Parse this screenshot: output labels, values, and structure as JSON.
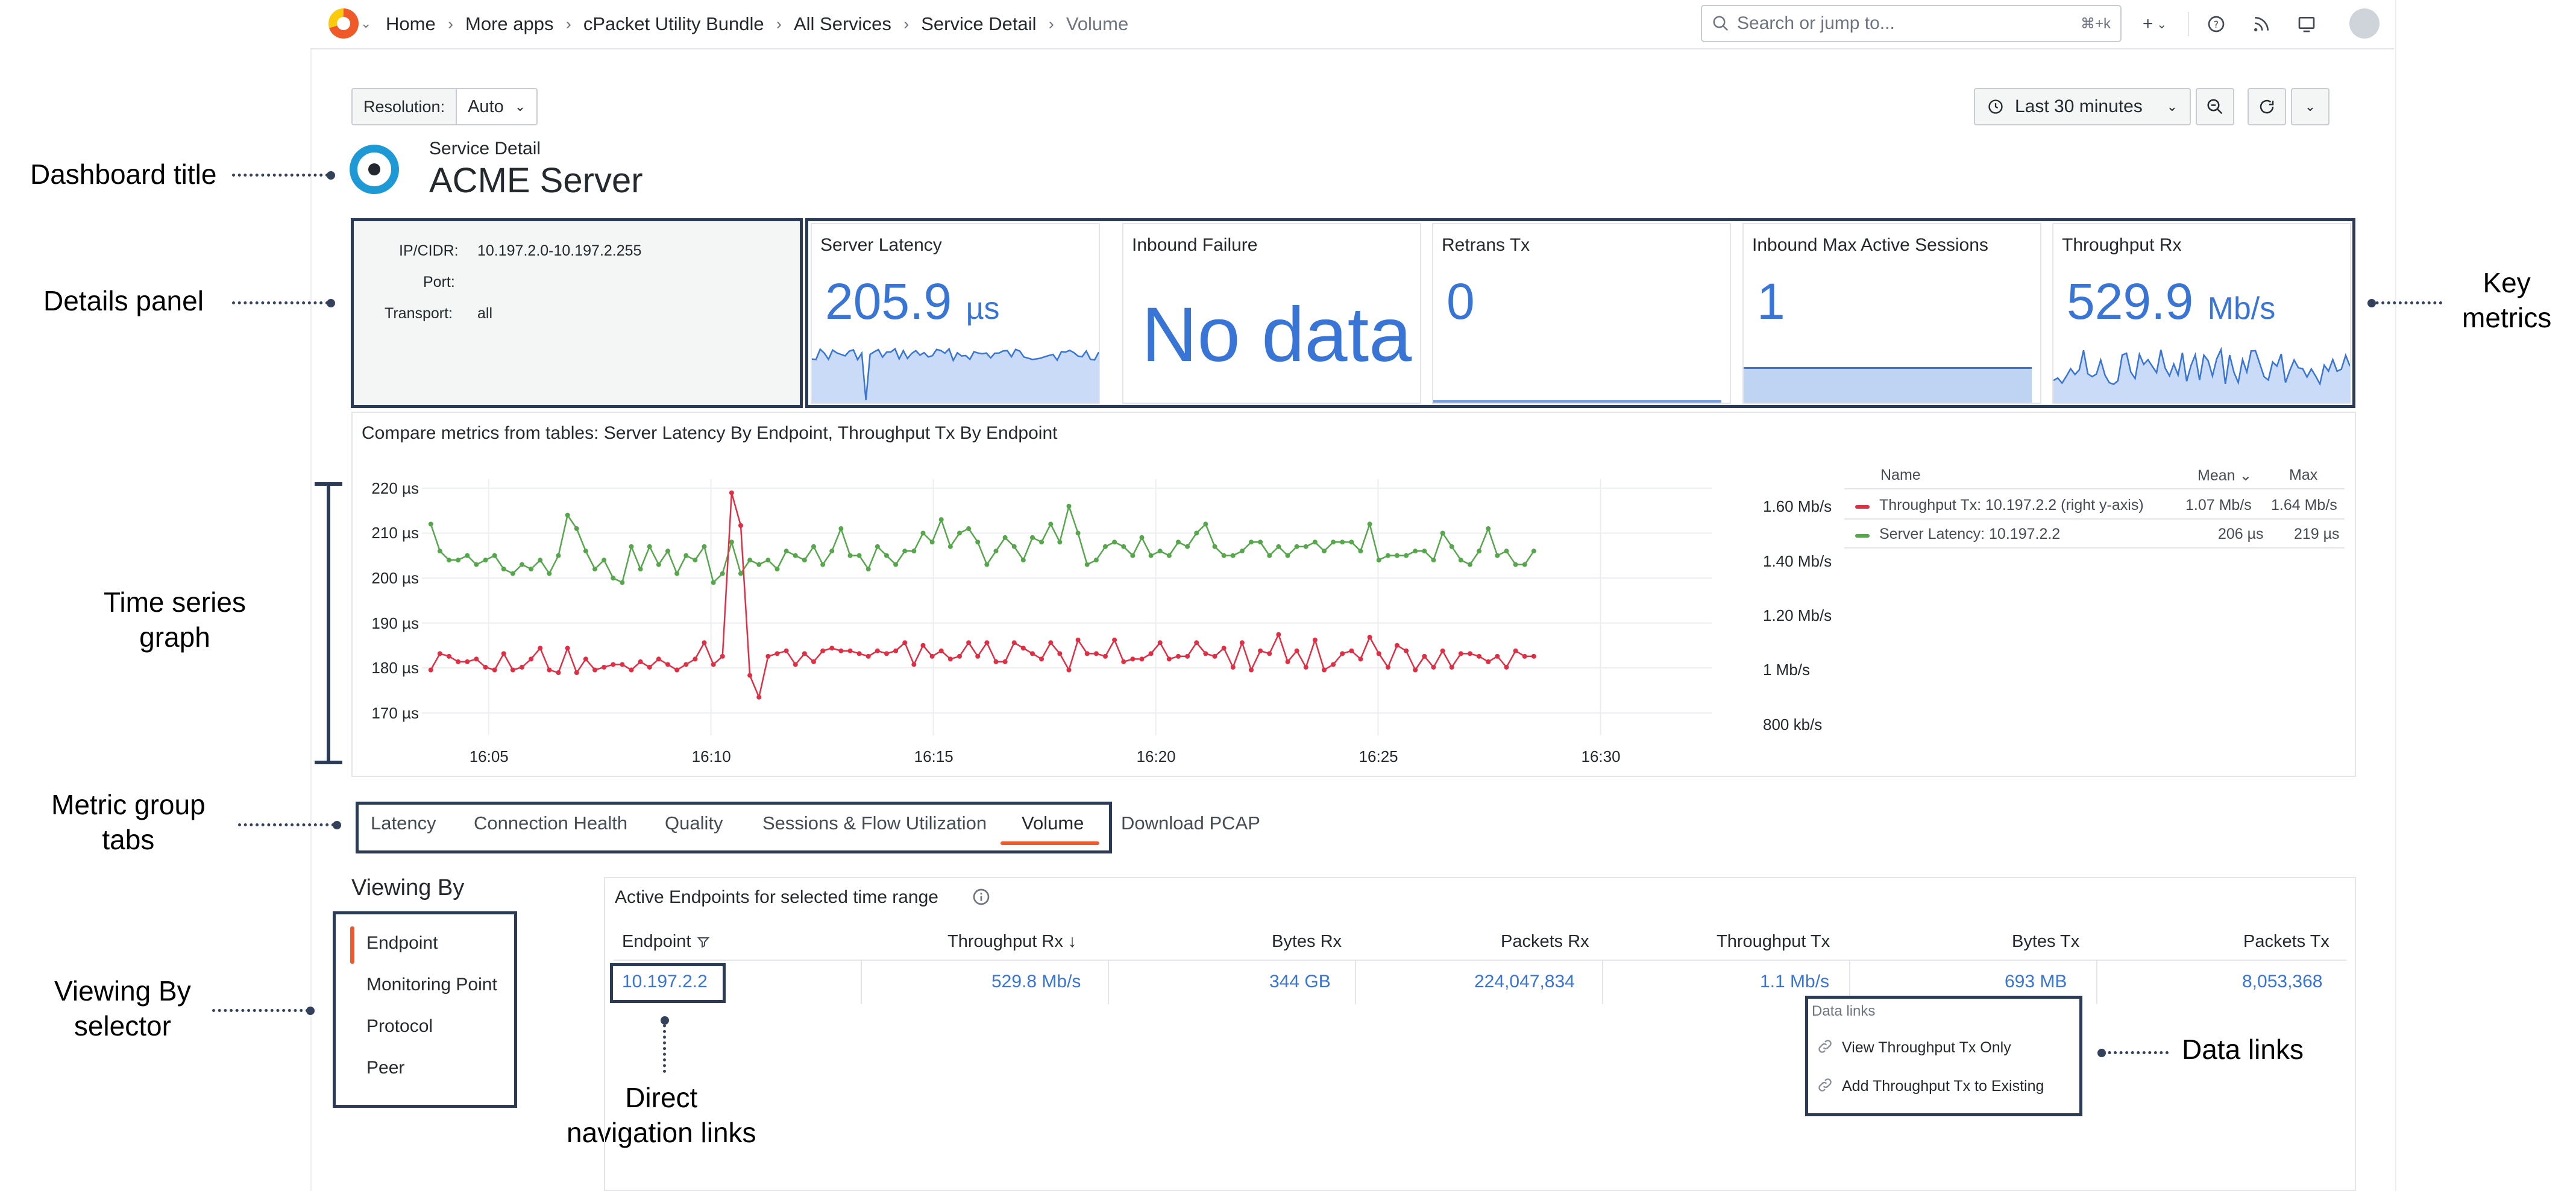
{
  "topnav": {
    "breadcrumbs": [
      "Home",
      "More apps",
      "cPacket Utility Bundle",
      "All Services",
      "Service Detail",
      "Volume"
    ],
    "search_placeholder": "Search or jump to...",
    "search_shortcut": "⌘+k",
    "plus_label": "+"
  },
  "controls": {
    "resolution_label": "Resolution:",
    "resolution_value": "Auto",
    "time_range": "Last 30 minutes"
  },
  "dashboard": {
    "subtitle": "Service Detail",
    "title": "ACME Server"
  },
  "details": [
    {
      "label": "IP/CIDR:",
      "value": "10.197.2.0-10.197.2.255"
    },
    {
      "label": "Port:",
      "value": ""
    },
    {
      "label": "Transport:",
      "value": "all"
    }
  ],
  "stats": [
    {
      "title": "Server Latency",
      "value": "205.9",
      "unit": "µs"
    },
    {
      "title": "Inbound Failure",
      "value": "No data",
      "unit": ""
    },
    {
      "title": "Retrans Tx",
      "value": "0",
      "unit": ""
    },
    {
      "title": "Inbound Max Active Sessions",
      "value": "1",
      "unit": ""
    },
    {
      "title": "Throughput Rx",
      "value": "529.9",
      "unit": "Mb/s"
    }
  ],
  "graph": {
    "title": "Compare metrics from tables: Server Latency By Endpoint, Throughput Tx By Endpoint",
    "legend_headers": {
      "name": "Name",
      "mean": "Mean",
      "max": "Max"
    },
    "legend": [
      {
        "name": "Throughput Tx: 10.197.2.2 (right y-axis)",
        "mean": "1.07 Mb/s",
        "max": "1.64 Mb/s",
        "color": "#e02f44"
      },
      {
        "name": "Server Latency: 10.197.2.2",
        "mean": "206 µs",
        "max": "219 µs",
        "color": "#56a64b"
      }
    ]
  },
  "chart_data": {
    "type": "line",
    "x_ticks": [
      "16:05",
      "16:10",
      "16:15",
      "16:20",
      "16:25",
      "16:30"
    ],
    "y_left_ticks": [
      "220 µs",
      "210 µs",
      "200 µs",
      "190 µs",
      "180 µs",
      "170 µs"
    ],
    "y_right_ticks": [
      "1.60 Mb/s",
      "1.40 Mb/s",
      "1.20 Mb/s",
      "1 Mb/s",
      "800 kb/s"
    ],
    "ylim_left": [
      165,
      222
    ],
    "ylim_right": [
      0.76,
      1.7
    ],
    "series": [
      {
        "name": "Server Latency: 10.197.2.2",
        "axis": "left",
        "color": "#56a64b",
        "values": [
          212,
          206,
          204,
          204,
          205,
          203,
          204,
          205,
          202,
          201,
          203,
          202,
          204,
          201,
          205,
          214,
          211,
          206,
          202,
          204,
          200,
          199,
          207,
          202,
          207,
          203,
          206,
          201,
          205,
          204,
          207,
          199,
          201,
          208,
          201,
          204,
          203,
          204,
          202,
          206,
          205,
          204,
          207,
          203,
          206,
          211,
          205,
          205,
          202,
          207,
          205,
          203,
          206,
          206,
          210,
          208,
          213,
          207,
          210,
          211,
          208,
          203,
          206,
          209,
          207,
          204,
          209,
          208,
          212,
          208,
          216,
          210,
          203,
          204,
          207,
          208,
          207,
          205,
          209,
          205,
          206,
          205,
          208,
          207,
          210,
          212,
          207,
          205,
          205,
          206,
          208,
          208,
          205,
          207,
          205,
          207,
          207,
          208,
          206,
          208,
          208,
          208,
          206,
          212,
          204,
          205,
          205,
          205,
          206,
          206,
          204,
          210,
          207,
          204,
          203,
          206,
          211,
          205,
          206,
          203,
          203,
          206
        ]
      },
      {
        "name": "Throughput Tx: 10.197.2.2 (right y-axis)",
        "axis": "right",
        "color": "#e02f44",
        "values": [
          1.0,
          1.06,
          1.05,
          1.03,
          1.03,
          1.04,
          1.01,
          1.0,
          1.06,
          1.0,
          1.01,
          1.04,
          1.08,
          1.0,
          0.99,
          1.08,
          0.99,
          1.04,
          1.0,
          1.01,
          1.02,
          1.02,
          1.0,
          1.03,
          1.01,
          1.04,
          1.02,
          1.0,
          1.02,
          1.04,
          1.1,
          1.02,
          1.05,
          1.65,
          1.53,
          0.98,
          0.9,
          1.05,
          1.06,
          1.07,
          1.02,
          1.06,
          1.03,
          1.07,
          1.08,
          1.07,
          1.07,
          1.06,
          1.05,
          1.07,
          1.06,
          1.07,
          1.1,
          1.02,
          1.09,
          1.05,
          1.07,
          1.04,
          1.05,
          1.1,
          1.05,
          1.1,
          1.03,
          1.03,
          1.1,
          1.08,
          1.06,
          1.04,
          1.1,
          1.06,
          1.0,
          1.11,
          1.06,
          1.06,
          1.05,
          1.11,
          1.03,
          1.04,
          1.04,
          1.06,
          1.1,
          1.04,
          1.05,
          1.05,
          1.1,
          1.06,
          1.05,
          1.08,
          1.01,
          1.1,
          1.0,
          1.07,
          1.06,
          1.13,
          1.03,
          1.07,
          1.01,
          1.11,
          1.0,
          1.02,
          1.06,
          1.07,
          1.04,
          1.12,
          1.06,
          1.01,
          1.09,
          1.07,
          1.0,
          1.05,
          1.01,
          1.07,
          1.01,
          1.06,
          1.06,
          1.05,
          1.03,
          1.05,
          1.01,
          1.07,
          1.05,
          1.05
        ]
      }
    ]
  },
  "tabs": [
    "Latency",
    "Connection Health",
    "Quality",
    "Sessions & Flow Utilization",
    "Volume",
    "Download PCAP"
  ],
  "active_tab": "Volume",
  "viewing_by": {
    "header": "Viewing By",
    "items": [
      "Endpoint",
      "Monitoring Point",
      "Protocol",
      "Peer"
    ]
  },
  "table": {
    "title": "Active Endpoints for selected time range",
    "columns": [
      "Endpoint",
      "Throughput Rx",
      "Bytes Rx",
      "Packets Rx",
      "Throughput Tx",
      "Bytes Tx",
      "Packets Tx"
    ],
    "rows": [
      [
        "10.197.2.2",
        "529.8 Mb/s",
        "344 GB",
        "224,047,834",
        "1.1 Mb/s",
        "693 MB",
        "8,053,368"
      ]
    ]
  },
  "data_links": {
    "header": "Data links",
    "items": [
      "View Throughput Tx Only",
      "Add Throughput Tx to Existing"
    ]
  },
  "annotations": {
    "dashboard_title": "Dashboard title",
    "details_panel": "Details panel",
    "key_metrics_1": "Key",
    "key_metrics_2": "metrics",
    "time_series_1": "Time series",
    "time_series_2": "graph",
    "metric_tabs_1": "Metric group",
    "metric_tabs_2": "tabs",
    "viewing_by_1": "Viewing By",
    "viewing_by_2": "selector",
    "data_links": "Data links",
    "direct_nav_1": "Direct",
    "direct_nav_2": "navigation links"
  }
}
